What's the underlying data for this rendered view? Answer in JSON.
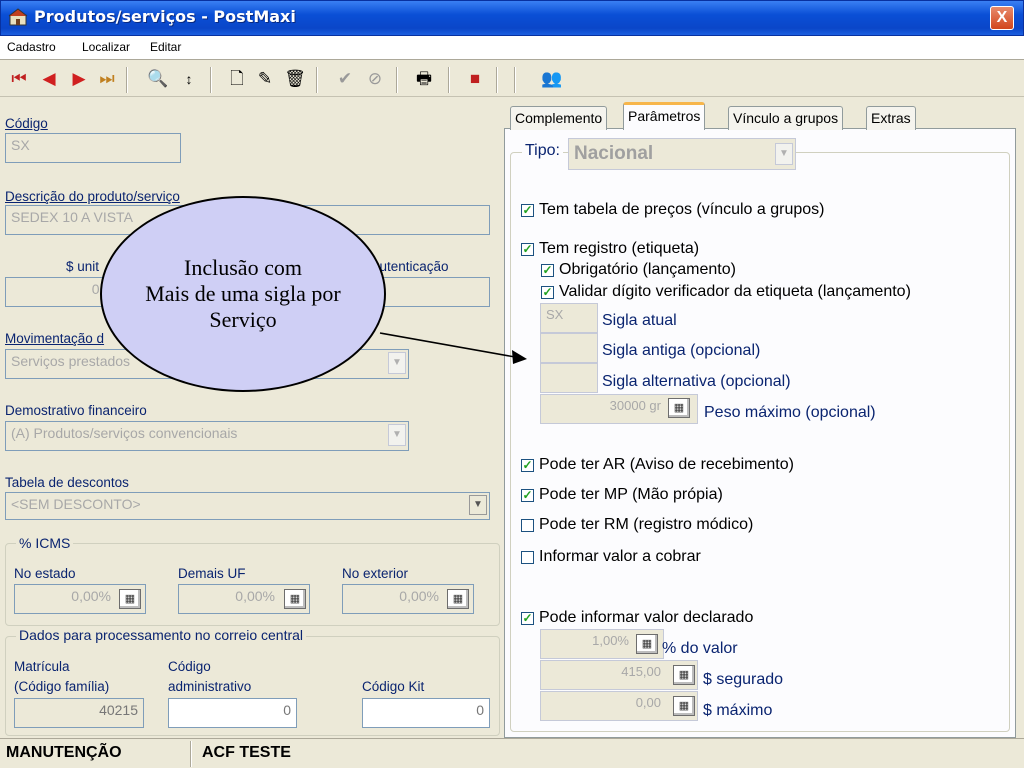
{
  "window": {
    "title": "Produtos/serviços - PostMaxi",
    "close_label": "X"
  },
  "menu": [
    "Cadastro",
    "Localizar",
    "Editar"
  ],
  "toolbar": {
    "icons": [
      "first-record-icon",
      "prev-record-icon",
      "next-record-icon",
      "last-record-icon",
      "find-icon",
      "sort-icon",
      "new-icon",
      "edit-icon",
      "delete-icon",
      "confirm-icon",
      "cancel-icon",
      "print-icon",
      "exit-icon",
      "users-icon"
    ]
  },
  "left": {
    "codigo_label": "Código",
    "codigo_value": "SX",
    "descricao_label": "Descrição do produto/serviço",
    "descricao_value": "SEDEX 10 A VISTA",
    "unit_label": "$ unit",
    "unit_value": "0,00",
    "autenticacao_label": "autenticação",
    "movimentacao_label": "Movimentação d",
    "movimentacao_value": "Serviços prestados",
    "demonstrativo_label": "Demostrativo financeiro",
    "demonstrativo_value": "(A) Produtos/serviços convencionais",
    "descontos_label": "Tabela de descontos",
    "descontos_value": "<SEM DESCONTO>",
    "icms": {
      "title": "% ICMS",
      "estado_label": "No estado",
      "estado_value": "0,00%",
      "uf_label": "Demais UF",
      "uf_value": "0,00%",
      "exterior_label": "No exterior",
      "exterior_value": "0,00%"
    },
    "correio": {
      "title": "Dados para processamento no correio central",
      "matricula_label_1": "Matrícula",
      "matricula_label_2": "(Código família)",
      "matricula_value": "40215",
      "codigo_adm_label_1": "Código",
      "codigo_adm_label_2": "administrativo",
      "codigo_adm_value": "0",
      "kit_label": "Código Kit",
      "kit_value": "0"
    }
  },
  "tabs": [
    "Complemento",
    "Parâmetros",
    "Vínculo a grupos",
    "Extras"
  ],
  "parametros": {
    "tipo_label": "Tipo:",
    "tipo_value": "Nacional",
    "tabela_precos": "Tem tabela de preços (vínculo a grupos)",
    "registro": "Tem registro (etiqueta)",
    "obrigatorio": "Obrigatório (lançamento)",
    "validar": "Validar dígito verificador da etiqueta (lançamento)",
    "sigla_atual_value": "SX",
    "sigla_atual": "Sigla atual",
    "sigla_antiga": "Sigla antiga (opcional)",
    "sigla_alternativa": "Sigla alternativa (opcional)",
    "peso_value": "30000 gr",
    "peso_label": "Peso máximo (opcional)",
    "ar": "Pode ter AR (Aviso de recebimento)",
    "mp": "Pode ter MP (Mão própia)",
    "rm": "Pode ter RM (registro módico)",
    "cobrar": "Informar valor a cobrar",
    "declarado": "Pode informar valor declarado",
    "pct_value": "1,00%",
    "pct_label": "% do valor",
    "segurado_value": "415,00",
    "segurado_label": "$ segurado",
    "maximo_value": "0,00",
    "maximo_label": "$ máximo",
    "checks": {
      "tabela_precos": true,
      "registro": true,
      "obrigatorio": true,
      "validar": true,
      "ar": true,
      "mp": true,
      "rm": false,
      "cobrar": false,
      "declarado": true
    },
    "check_mark": "✓"
  },
  "status": {
    "mode": "MANUTENÇÃO",
    "user": "ACF TESTE"
  },
  "callout": {
    "line1": "Inclusão com",
    "line2": "Mais de uma sigla por",
    "line3": "Serviço"
  }
}
